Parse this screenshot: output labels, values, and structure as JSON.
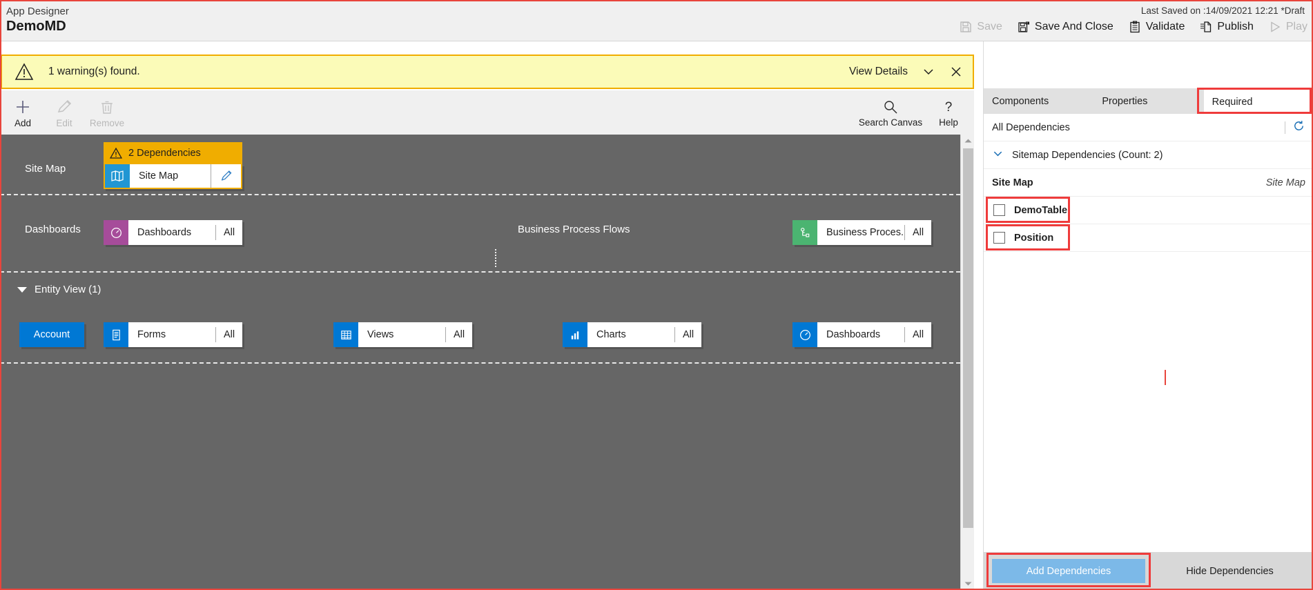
{
  "header": {
    "app_designer_label": "App Designer",
    "app_title": "DemoMD",
    "last_saved": "Last Saved on :14/09/2021 12:21 *Draft",
    "commands": [
      {
        "label": "Save",
        "icon": "save-icon",
        "disabled": true
      },
      {
        "label": "Save And Close",
        "icon": "save-and-close-icon",
        "disabled": false
      },
      {
        "label": "Validate",
        "icon": "validate-clipboard-icon",
        "disabled": false
      },
      {
        "label": "Publish",
        "icon": "publish-icon",
        "disabled": false
      },
      {
        "label": "Play",
        "icon": "play-icon",
        "disabled": true
      }
    ]
  },
  "warning": {
    "icon": "warning-triangle-icon",
    "message": "1 warning(s) found.",
    "view_details": "View Details",
    "chevron_icon": "chevron-down-icon",
    "close_icon": "close-icon",
    "background": "#fbfbb8",
    "border": "#f0ad00"
  },
  "command_bar": {
    "add": {
      "label": "Add",
      "icon": "plus-icon",
      "disabled": false
    },
    "edit": {
      "label": "Edit",
      "icon": "pencil-icon",
      "disabled": true
    },
    "remove": {
      "label": "Remove",
      "icon": "trash-icon",
      "disabled": true
    },
    "search_canvas": {
      "label": "Search Canvas",
      "icon": "search-icon"
    },
    "help": {
      "label": "Help",
      "icon": "question-mark-icon"
    }
  },
  "canvas": {
    "sitemap_zone": {
      "label": "Site Map",
      "dependencies_badge": "2 Dependencies",
      "dependencies_icon": "warning-triangle-icon",
      "tile_label": "Site Map",
      "tile_icon": "map-icon",
      "edit_icon": "pencil-icon"
    },
    "dashboards_zone": {
      "label": "Dashboards",
      "tile_label": "Dashboards",
      "tile_all": "All",
      "tile_icon": "dashboard-gauge-icon",
      "tile_color": "#a64c9a"
    },
    "bpf_zone": {
      "label": "Business Process Flows",
      "tile_label": "Business Proces...",
      "tile_all": "All",
      "tile_icon": "process-flow-icon",
      "tile_color": "#4bb471"
    },
    "entity_view": {
      "label": "Entity View (1)",
      "entity_button": "Account",
      "tiles": [
        {
          "label": "Forms",
          "all": "All",
          "icon": "form-icon",
          "color": "#0078d4"
        },
        {
          "label": "Views",
          "all": "All",
          "icon": "grid-view-icon",
          "color": "#0078d4"
        },
        {
          "label": "Charts",
          "all": "All",
          "icon": "bar-chart-icon",
          "color": "#0078d4"
        },
        {
          "label": "Dashboards",
          "all": "All",
          "icon": "dashboard-gauge-icon",
          "color": "#0078d4"
        }
      ]
    }
  },
  "right_panel": {
    "tabs": [
      {
        "label": "Components",
        "active": false
      },
      {
        "label": "Properties",
        "active": false
      },
      {
        "label": "Required",
        "active": true
      }
    ],
    "all_dependencies_label": "All Dependencies",
    "refresh_icon": "refresh-icon",
    "group": {
      "label": "Sitemap Dependencies (Count: 2)",
      "chevron_icon": "chevron-down-icon"
    },
    "subheader": {
      "left": "Site Map",
      "right": "Site Map"
    },
    "items": [
      {
        "label": "DemoTable",
        "checked": false
      },
      {
        "label": "Position",
        "checked": false
      }
    ],
    "add_dependencies_button": "Add Dependencies",
    "hide_dependencies_button": "Hide Dependencies",
    "add_button_color": "#7cb9e8"
  },
  "annotation_color": "#ef3b3b"
}
